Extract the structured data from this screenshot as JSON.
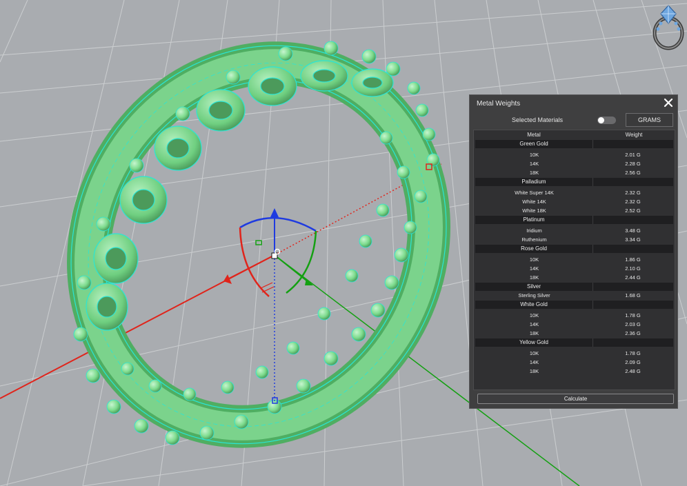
{
  "colors": {
    "viewport_background": "#a9acb0",
    "grid_line": "#d2d4d6",
    "axis_x": "#e0241b",
    "axis_y": "#14a012",
    "axis_z": "#1f3be0",
    "model_fill": "#79d98c",
    "model_wire": "#2ae6d6",
    "panel_background": "#3f3f40"
  },
  "icons": {
    "logo": "ring-logo-icon",
    "close": "close-icon"
  },
  "panel": {
    "title": "Metal Weights",
    "selected_materials_label": "Selected Materials",
    "selected_materials_on": false,
    "units_button": "GRAMS",
    "columns": {
      "metal": "Metal",
      "weight": "Weight"
    },
    "groups": [
      {
        "name": "Green Gold",
        "items": [
          {
            "metal": "10K",
            "weight": "2.01 G"
          },
          {
            "metal": "14K",
            "weight": "2.28 G"
          },
          {
            "metal": "18K",
            "weight": "2.56 G"
          }
        ]
      },
      {
        "name": "Palladium",
        "items": [
          {
            "metal": "White Super 14K",
            "weight": "2.32 G"
          },
          {
            "metal": "White 14K",
            "weight": "2.32 G"
          },
          {
            "metal": "White 18K",
            "weight": "2.52 G"
          }
        ]
      },
      {
        "name": "Platinum",
        "items": [
          {
            "metal": "Iridium",
            "weight": "3.48 G"
          },
          {
            "metal": "Ruthenium",
            "weight": "3.34 G"
          }
        ]
      },
      {
        "name": "Rose Gold",
        "items": [
          {
            "metal": "10K",
            "weight": "1.86 G"
          },
          {
            "metal": "14K",
            "weight": "2.10 G"
          },
          {
            "metal": "18K",
            "weight": "2.44 G"
          }
        ]
      },
      {
        "name": "Silver",
        "items": [
          {
            "metal": "Sterling Silver",
            "weight": "1.68 G"
          }
        ]
      },
      {
        "name": "White Gold",
        "items": [
          {
            "metal": "10K",
            "weight": "1.78 G"
          },
          {
            "metal": "14K",
            "weight": "2.03 G"
          },
          {
            "metal": "18K",
            "weight": "2.36 G"
          }
        ]
      },
      {
        "name": "Yellow Gold",
        "items": [
          {
            "metal": "10K",
            "weight": "1.78 G"
          },
          {
            "metal": "14K",
            "weight": "2.09 G"
          },
          {
            "metal": "18K",
            "weight": "2.48 G"
          }
        ]
      }
    ],
    "calculate_button": "Calculate"
  }
}
